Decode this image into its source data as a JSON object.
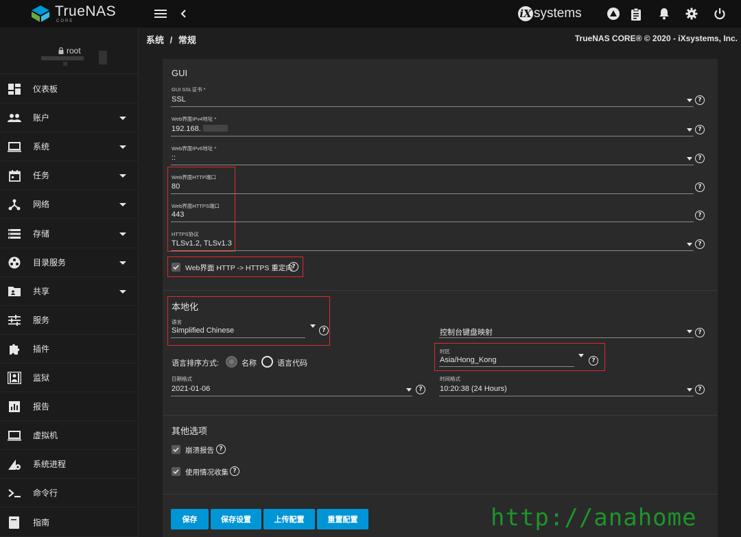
{
  "app": {
    "logo_text": "TrueNAS",
    "logo_sub": "CORE",
    "vendor_logo_text": "systems"
  },
  "header": {
    "breadcrumb_root": "系统",
    "breadcrumb_sep": "/",
    "breadcrumb_current": "常规",
    "copyright": "TrueNAS CORE® © 2020 - iXsystems, Inc."
  },
  "user": {
    "name": "root"
  },
  "sidebar": {
    "items": [
      {
        "label": "仪表板",
        "icon": "dashboard-icon",
        "expandable": false
      },
      {
        "label": "账户",
        "icon": "people-icon",
        "expandable": true
      },
      {
        "label": "系统",
        "icon": "computer-icon",
        "expandable": true
      },
      {
        "label": "任务",
        "icon": "calendar-icon",
        "expandable": true
      },
      {
        "label": "网络",
        "icon": "network-icon",
        "expandable": true
      },
      {
        "label": "存储",
        "icon": "storage-icon",
        "expandable": true
      },
      {
        "label": "目录服务",
        "icon": "directory-icon",
        "expandable": true
      },
      {
        "label": "共享",
        "icon": "folder-share-icon",
        "expandable": true
      },
      {
        "label": "服务",
        "icon": "tune-icon",
        "expandable": false
      },
      {
        "label": "插件",
        "icon": "puzzle-icon",
        "expandable": false
      },
      {
        "label": "监狱",
        "icon": "jail-icon",
        "expandable": false
      },
      {
        "label": "报告",
        "icon": "chart-icon",
        "expandable": false
      },
      {
        "label": "虚拟机",
        "icon": "laptop-icon",
        "expandable": false
      },
      {
        "label": "系统进程",
        "icon": "process-icon",
        "expandable": false
      },
      {
        "label": "命令行",
        "icon": "terminal-icon",
        "expandable": false
      },
      {
        "label": "指南",
        "icon": "book-icon",
        "expandable": false
      }
    ]
  },
  "gui": {
    "title": "GUI",
    "ssl_cert": {
      "label": "GUI SSL证书 *",
      "value": "SSL"
    },
    "ipv4": {
      "label": "Web界面IPv4地址 *",
      "value": "192.168."
    },
    "ipv6": {
      "label": "Web界面IPv6地址 *",
      "value": "::"
    },
    "http_port": {
      "label": "Web界面HTTP端口",
      "value": "80"
    },
    "https_port": {
      "label": "Web界面HTTPS端口",
      "value": "443"
    },
    "https_proto": {
      "label": "HTTPS协议",
      "value": "TLSv1.2, TLSv1.3"
    },
    "redirect": {
      "label": "Web界面 HTTP -> HTTPS 重定向",
      "checked": true
    }
  },
  "locale": {
    "title": "本地化",
    "language": {
      "label": "语言",
      "value": "Simplified Chinese"
    },
    "console_keymap": {
      "label": "控制台键盘映射",
      "value": ""
    },
    "sort_label": "语言排序方式:",
    "sort_options": [
      {
        "label": "名称",
        "selected": true
      },
      {
        "label": "语言代码",
        "selected": false
      }
    ],
    "timezone": {
      "label": "时区",
      "value": "Asia/Hong_Kong"
    },
    "date_format": {
      "label": "日期格式",
      "value": "2021-01-06"
    },
    "time_format": {
      "label": "时间格式",
      "value": "10:20:38 (24 Hours)"
    }
  },
  "other": {
    "title": "其他选项",
    "crash_report": {
      "label": "崩溃报告",
      "checked": true
    },
    "usage_collection": {
      "label": "使用情况收集",
      "checked": true
    }
  },
  "buttons": {
    "save": "保存",
    "save_config": "保存设置",
    "upload_config": "上传配置",
    "reset_config": "重置配置"
  },
  "watermark": "http://anahome",
  "colors": {
    "accent": "#0095d5",
    "highlight_box": "#e02a2a",
    "topbar": "#111111",
    "panel": "#2a2a2a"
  }
}
